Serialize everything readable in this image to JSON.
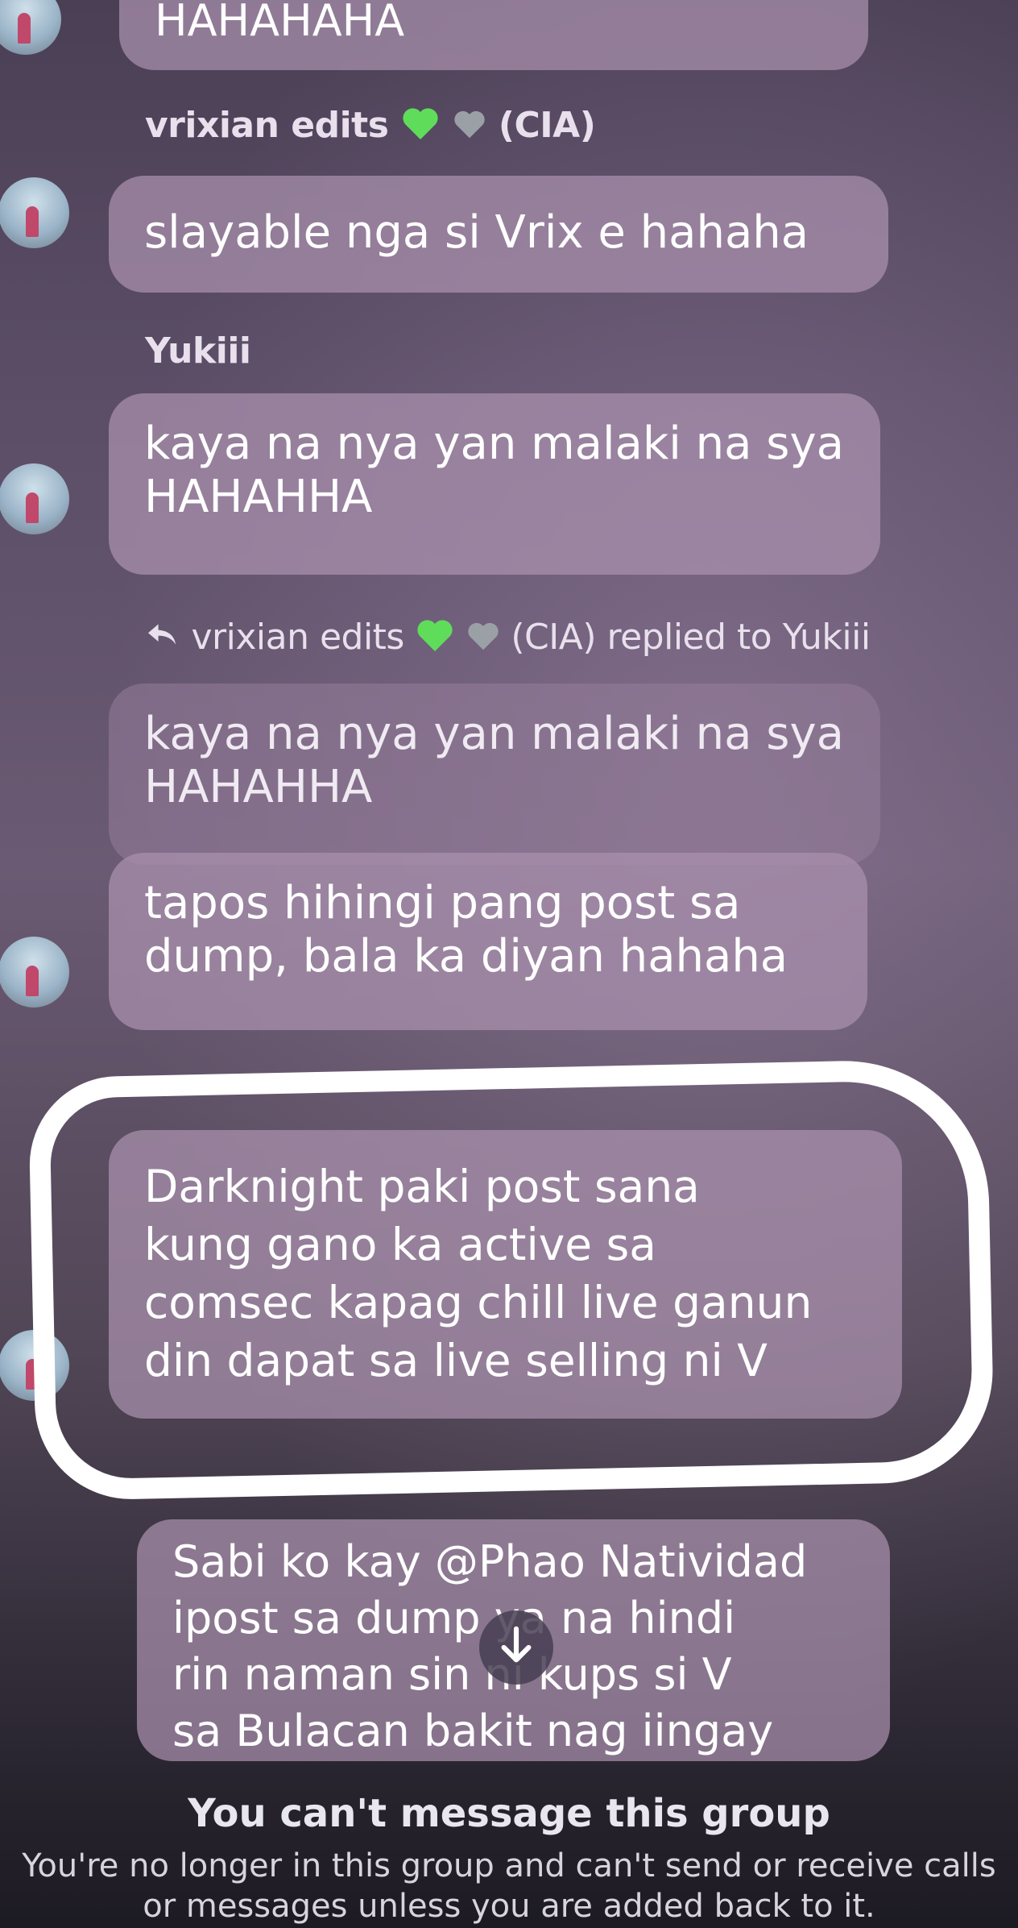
{
  "messages": {
    "m0": {
      "text": "HAHAHAHA"
    },
    "m1": {
      "sender": "vrixian edits",
      "sender_tag": "(CIA)",
      "text": "slayable nga si Vrix e hahaha"
    },
    "m2": {
      "sender": "Yukiii",
      "lines": [
        "kaya na nya yan malaki na sya",
        "HAHAHHA"
      ]
    },
    "m3": {
      "reply_header": "vrixian edits",
      "reply_tag": "(CIA) replied to Yukiii",
      "quoted_lines": [
        "kaya na nya yan malaki na sya",
        "HAHAHHA"
      ],
      "lines": [
        "tapos hihingi pang post sa",
        "dump, bala ka diyan hahaha"
      ]
    },
    "m4": {
      "lines": [
        "Darknight paki post sana",
        "kung gano ka active sa",
        "comsec kapag chill live ganun",
        "din dapat sa live selling ni V"
      ]
    },
    "m5": {
      "lines": [
        "Sabi ko kay @Phao Natividad",
        "ipost sa dump  ya na hindi",
        "rin naman sin     ni kups si V",
        "sa Bulacan bakit nag iingay"
      ]
    }
  },
  "icons": {
    "reply": "reply-arrow-icon",
    "heart_green": "#5fdc5a",
    "heart_grey": "#9aa0a6",
    "scroll_down": "arrow-down-icon"
  },
  "footer": {
    "title": "You can't message this group",
    "line1": "You're no longer in this group and can't send or receive calls",
    "line2": "or messages unless you are added back to it."
  }
}
